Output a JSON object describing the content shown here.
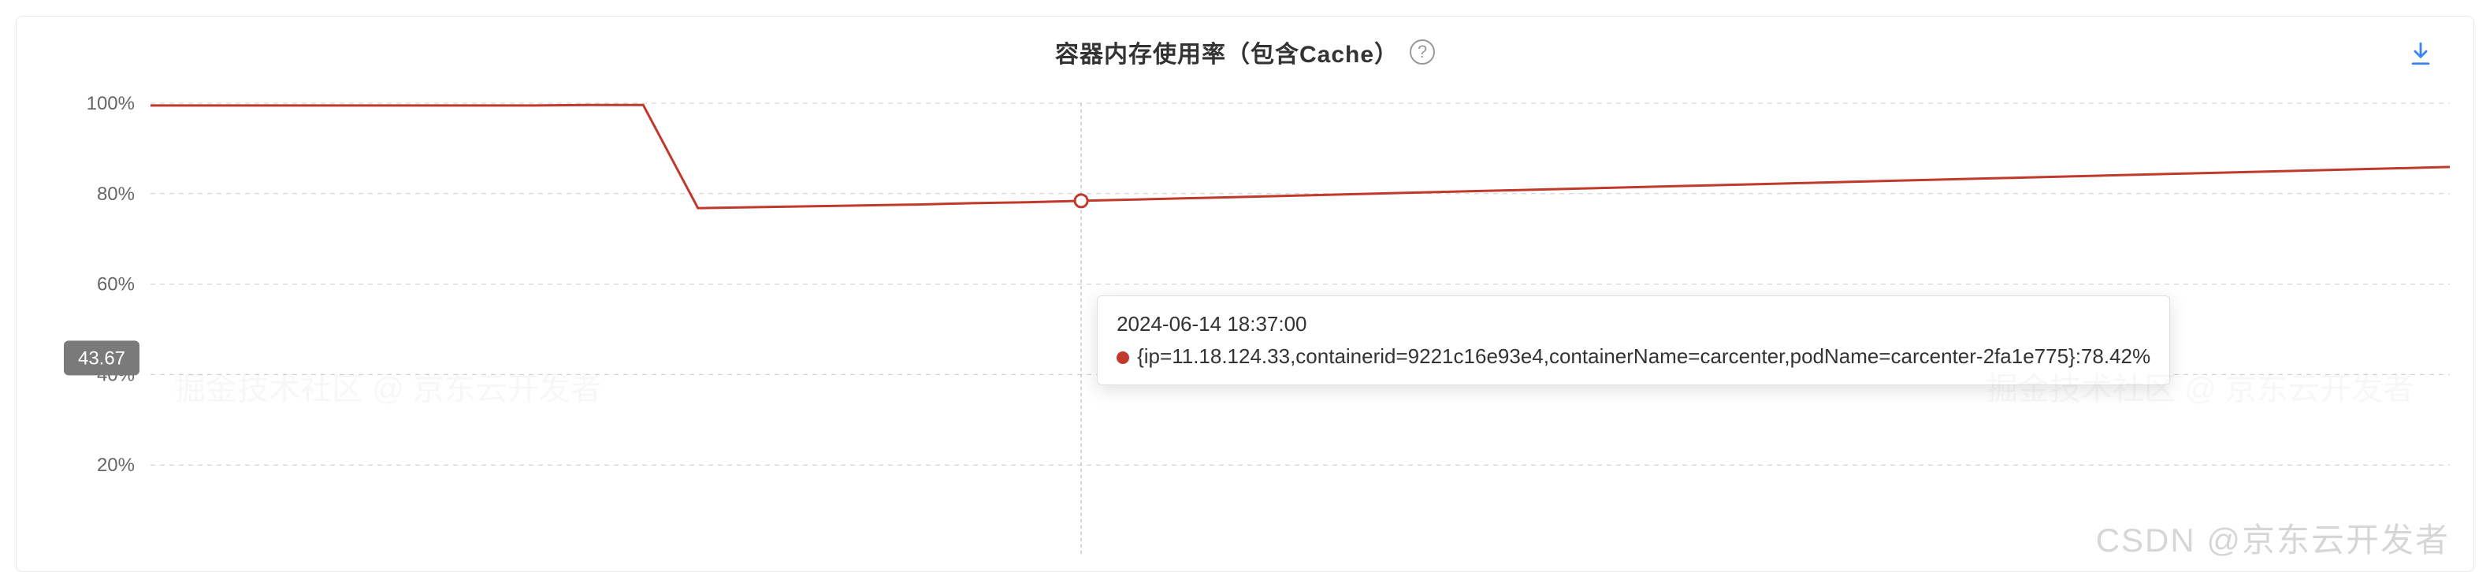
{
  "title": "容器内存使用率（包含Cache）",
  "help_label": "?",
  "download_label": "download",
  "badge_value": "43.67",
  "tooltip": {
    "timestamp": "2024-06-14 18:37:00",
    "series_text": "{ip=11.18.124.33,containerid=9221c16e93e4,containerName=carcenter,podName=carcenter-2fa1e775}:78.42%"
  },
  "watermark_main": "CSDN @京东云开发者",
  "watermark_faint": "掘金技术社区 @ 京东云开发者",
  "chart_data": {
    "type": "line",
    "title": "容器内存使用率（包含Cache）",
    "xlabel": "",
    "ylabel": "",
    "ylim": [
      0,
      100
    ],
    "yticks": [
      20,
      40,
      60,
      80,
      100
    ],
    "ytick_labels": [
      "20%",
      "40%",
      "60%",
      "80%",
      "100%"
    ],
    "series": [
      {
        "name": "{ip=11.18.124.33,containerid=9221c16e93e4,containerName=carcenter,podName=carcenter-2fa1e775}",
        "color": "#c0392b",
        "hover": {
          "x_index": 17,
          "timestamp": "2024-06-14 18:37:00",
          "value": 78.42
        },
        "values": [
          99.5,
          99.5,
          99.5,
          99.5,
          99.5,
          99.5,
          99.5,
          99.5,
          99.6,
          99.6,
          76.8,
          77.0,
          77.2,
          77.4,
          77.6,
          77.9,
          78.1,
          78.42,
          78.7,
          79.0,
          79.3,
          79.6,
          79.9,
          80.2,
          80.5,
          80.8,
          81.1,
          81.4,
          81.7,
          82.0,
          82.3,
          82.6,
          82.9,
          83.2,
          83.5,
          83.8,
          84.1,
          84.4,
          84.7,
          85.0,
          85.3,
          85.6,
          85.9
        ]
      }
    ],
    "reference_line": 43.67
  }
}
